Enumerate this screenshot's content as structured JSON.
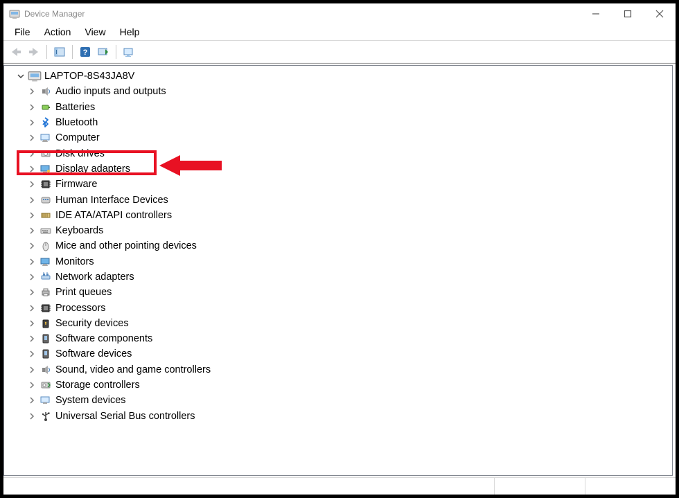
{
  "window": {
    "title": "Device Manager"
  },
  "menubar": {
    "file": "File",
    "action": "Action",
    "view": "View",
    "help": "Help"
  },
  "tree": {
    "root_label": "LAPTOP-8S43JA8V",
    "items": [
      {
        "label": "Audio inputs and outputs",
        "icon": "audio"
      },
      {
        "label": "Batteries",
        "icon": "battery"
      },
      {
        "label": "Bluetooth",
        "icon": "bluetooth"
      },
      {
        "label": "Computer",
        "icon": "computer"
      },
      {
        "label": "Disk drives",
        "icon": "disk"
      },
      {
        "label": "Display adapters",
        "icon": "display",
        "highlighted": true
      },
      {
        "label": "Firmware",
        "icon": "chip"
      },
      {
        "label": "Human Interface Devices",
        "icon": "hid"
      },
      {
        "label": "IDE ATA/ATAPI controllers",
        "icon": "ide"
      },
      {
        "label": "Keyboards",
        "icon": "keyboard"
      },
      {
        "label": "Mice and other pointing devices",
        "icon": "mouse"
      },
      {
        "label": "Monitors",
        "icon": "monitor"
      },
      {
        "label": "Network adapters",
        "icon": "network"
      },
      {
        "label": "Print queues",
        "icon": "printer"
      },
      {
        "label": "Processors",
        "icon": "chip"
      },
      {
        "label": "Security devices",
        "icon": "security"
      },
      {
        "label": "Software components",
        "icon": "sw"
      },
      {
        "label": "Software devices",
        "icon": "sw"
      },
      {
        "label": "Sound, video and game controllers",
        "icon": "audio"
      },
      {
        "label": "Storage controllers",
        "icon": "storage"
      },
      {
        "label": "System devices",
        "icon": "system"
      },
      {
        "label": "Universal Serial Bus controllers",
        "icon": "usb"
      }
    ]
  },
  "annotation": {
    "highlight_color": "#e81123"
  }
}
